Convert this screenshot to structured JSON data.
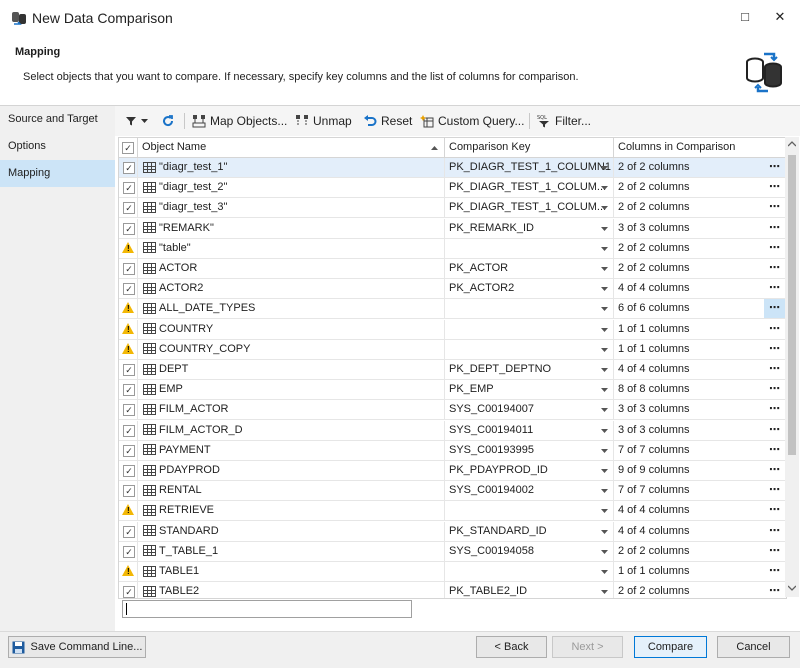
{
  "window": {
    "title": "New Data Comparison",
    "maximize_glyph": "□",
    "close_glyph": "✕"
  },
  "header": {
    "title": "Mapping",
    "description": "Select objects that you want to compare. If necessary, specify key columns and the list of columns for comparison."
  },
  "sidebar": {
    "items": [
      {
        "label": "Source and Target"
      },
      {
        "label": "Options"
      },
      {
        "label": "Mapping"
      }
    ]
  },
  "toolbar": {
    "map_objects": "Map Objects...",
    "unmap": "Unmap",
    "reset": "Reset",
    "custom_query": "Custom Query...",
    "filter": "Filter..."
  },
  "grid": {
    "headers": {
      "object_name": "Object Name",
      "comparison_key": "Comparison Key",
      "columns": "Columns in Comparison"
    },
    "more": "⋯",
    "rows": [
      {
        "state": "checked",
        "name": "\"diagr_test_1\"",
        "key": "PK_DIAGR_TEST_1_COLUMN1",
        "columns": "2 of 2 columns"
      },
      {
        "state": "checked",
        "name": "\"diagr_test_2\"",
        "key": "PK_DIAGR_TEST_1_COLUM...",
        "columns": "2 of 2 columns"
      },
      {
        "state": "checked",
        "name": "\"diagr_test_3\"",
        "key": "PK_DIAGR_TEST_1_COLUM...",
        "columns": "2 of 2 columns"
      },
      {
        "state": "checked",
        "name": "\"REMARK\"",
        "key": "PK_REMARK_ID",
        "columns": "3 of 3 columns"
      },
      {
        "state": "warning",
        "name": "\"table\"",
        "key": "",
        "columns": "2 of 2 columns"
      },
      {
        "state": "checked",
        "name": "ACTOR",
        "key": "PK_ACTOR",
        "columns": "2 of 2 columns"
      },
      {
        "state": "checked",
        "name": "ACTOR2",
        "key": "PK_ACTOR2",
        "columns": "4 of 4 columns"
      },
      {
        "state": "warning",
        "name": "ALL_DATE_TYPES",
        "key": "",
        "columns": "6 of 6 columns"
      },
      {
        "state": "warning",
        "name": "COUNTRY",
        "key": "",
        "columns": "1 of 1 columns"
      },
      {
        "state": "warning",
        "name": "COUNTRY_COPY",
        "key": "",
        "columns": "1 of 1 columns"
      },
      {
        "state": "checked",
        "name": "DEPT",
        "key": "PK_DEPT_DEPTNO",
        "columns": "4 of 4 columns"
      },
      {
        "state": "checked",
        "name": "EMP",
        "key": "PK_EMP",
        "columns": "8 of 8 columns"
      },
      {
        "state": "checked",
        "name": "FILM_ACTOR",
        "key": "SYS_C00194007",
        "columns": "3 of 3 columns"
      },
      {
        "state": "checked",
        "name": "FILM_ACTOR_D",
        "key": "SYS_C00194011",
        "columns": "3 of 3 columns"
      },
      {
        "state": "checked",
        "name": "PAYMENT",
        "key": "SYS_C00193995",
        "columns": "7 of 7 columns"
      },
      {
        "state": "checked",
        "name": "PDAYPROD",
        "key": "PK_PDAYPROD_ID",
        "columns": "9 of 9 columns"
      },
      {
        "state": "checked",
        "name": "RENTAL",
        "key": "SYS_C00194002",
        "columns": "7 of 7 columns"
      },
      {
        "state": "warning",
        "name": "RETRIEVE",
        "key": "",
        "columns": "4 of 4 columns"
      },
      {
        "state": "checked",
        "name": "STANDARD",
        "key": "PK_STANDARD_ID",
        "columns": "4 of 4 columns"
      },
      {
        "state": "checked",
        "name": "T_TABLE_1",
        "key": "SYS_C00194058",
        "columns": "2 of 2 columns"
      },
      {
        "state": "warning",
        "name": "TABLE1",
        "key": "",
        "columns": "1 of 1 columns"
      },
      {
        "state": "checked",
        "name": "TABLE2",
        "key": "PK_TABLE2_ID",
        "columns": "2 of 2 columns"
      }
    ]
  },
  "footer": {
    "save_command_line": "Save Command Line...",
    "back": "< Back",
    "next": "Next >",
    "compare": "Compare",
    "cancel": "Cancel"
  },
  "colors": {
    "accent": "#0078d7",
    "selection": "#cce4f7",
    "warning": "#f2b705",
    "refresh": "#1a73c8"
  }
}
